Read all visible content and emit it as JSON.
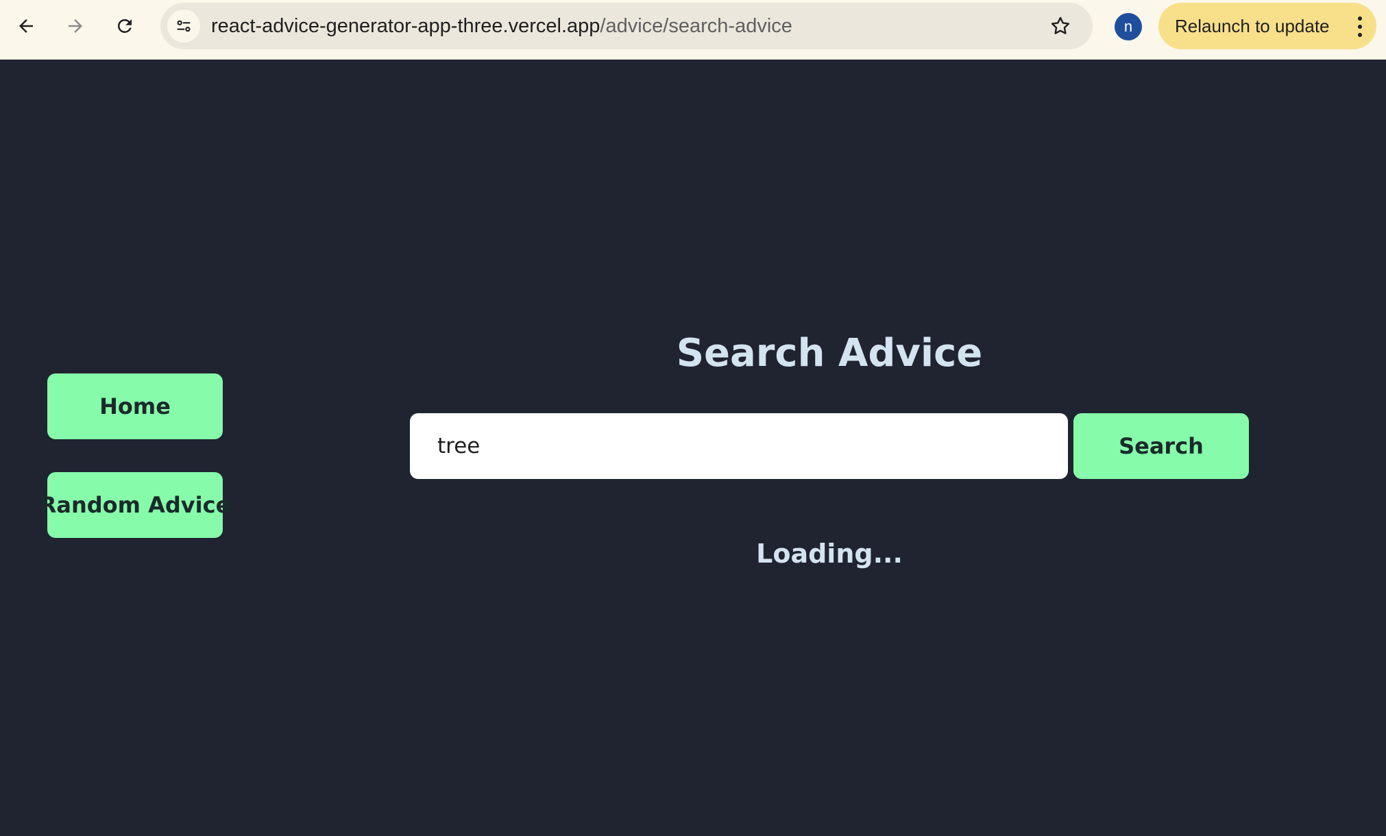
{
  "browser": {
    "url_host": "react-advice-generator-app-three.vercel.app",
    "url_path": "/advice/search-advice",
    "profile_initial": "n",
    "relaunch_label": "Relaunch to update",
    "icons": [
      "back-arrow-icon",
      "forward-arrow-icon",
      "reload-icon",
      "site-settings-icon",
      "star-icon",
      "more-vert-icon"
    ]
  },
  "sidebar": {
    "items": [
      {
        "label": "Home"
      },
      {
        "label": "Random Advice"
      }
    ]
  },
  "main": {
    "title": "Search Advice",
    "search": {
      "value": "tree",
      "button_label": "Search"
    },
    "status": "Loading..."
  },
  "colors": {
    "background": "#1f2430",
    "accent": "#86fbaa",
    "heading_text": "#d3e3ef"
  }
}
